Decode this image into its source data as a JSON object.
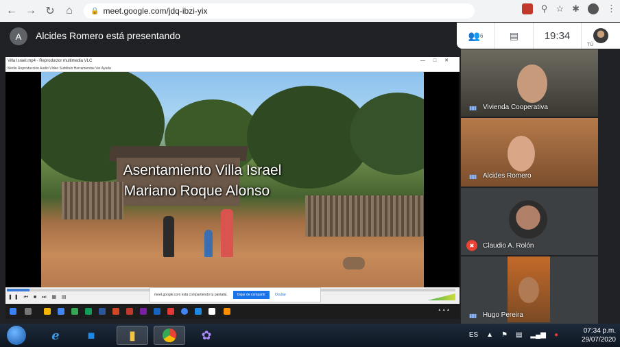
{
  "browser": {
    "url": "meet.google.com/jdq-ibzi-yix"
  },
  "meet": {
    "presenter_initial": "A",
    "presenter_text": "Alcides Romero está presentando",
    "people_count": "6",
    "time": "19:34",
    "self_label": "TÚ"
  },
  "presentation": {
    "window_title": "Villa Israel.mp4 - Reproductor multimedia VLC",
    "menu": "Medio   Reproducción   Audio   Vídeo   Subtítulo   Herramientas   Ver   Ayuda",
    "overlay_line1": "Asentamiento Villa Israel",
    "overlay_line2": "Mariano Roque Alonso",
    "share_notice": "meet.google.com está compartiendo tu pantalla.",
    "share_stop": "Dejar de compartir",
    "share_hide": "Ocultar",
    "progress_fraction": 0.05
  },
  "participants": [
    {
      "name": "Vivienda Cooperativa",
      "muted": false
    },
    {
      "name": "Alcides Romero",
      "muted": false
    },
    {
      "name": "Claudio A. Rolón",
      "muted": true
    },
    {
      "name": "Hugo Pereira",
      "muted": false
    }
  ],
  "taskbar": {
    "language": "ES",
    "time": "07:34 p.m.",
    "date": "29/07/2020"
  },
  "colors": {
    "meet_bg": "#202124",
    "accent_blue": "#1a73e8",
    "mute_red": "#ea4335"
  }
}
